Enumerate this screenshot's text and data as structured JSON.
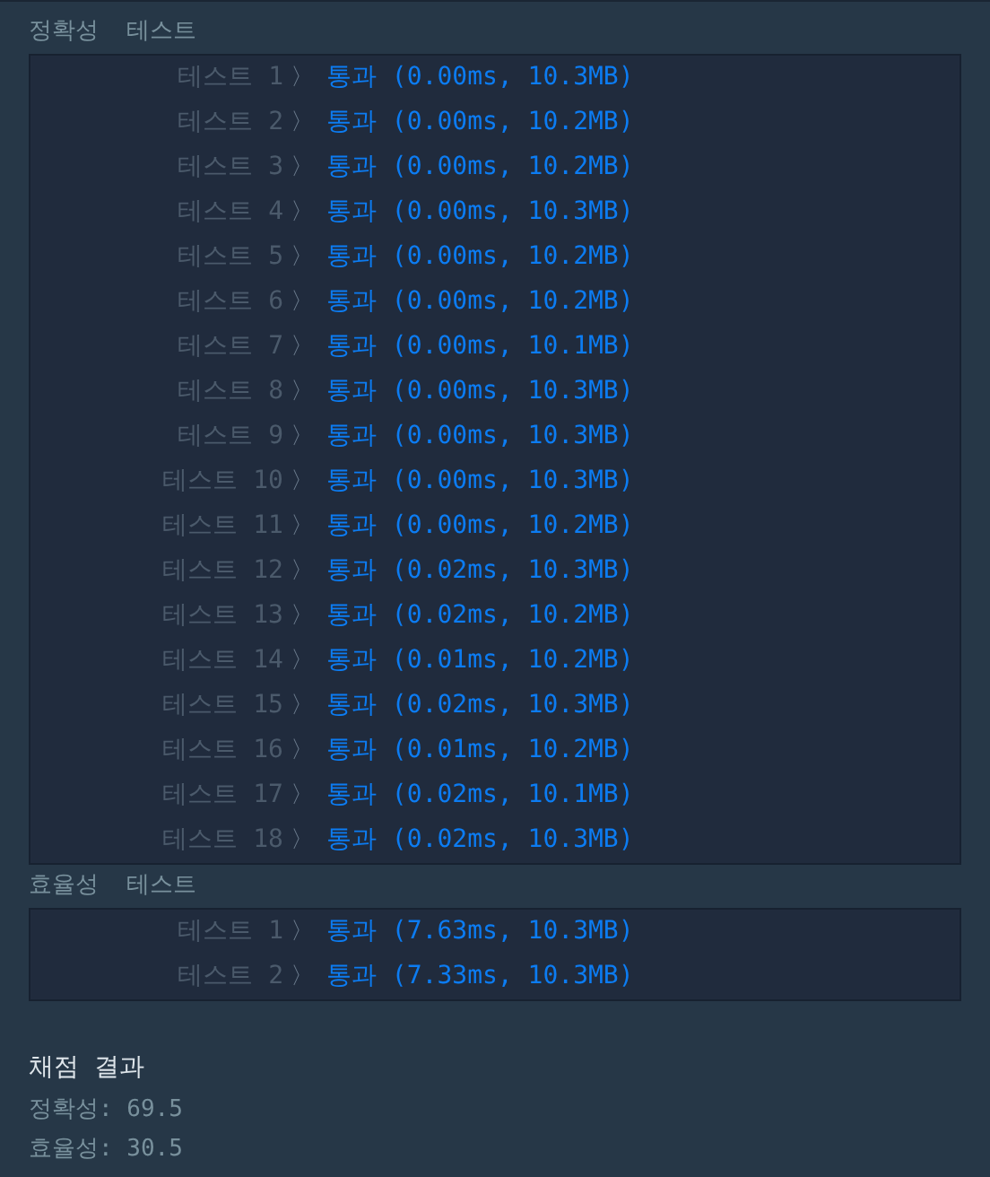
{
  "sections": [
    {
      "title": "정확성  테스트",
      "tests": [
        {
          "label": "테스트 1",
          "separator": "〉",
          "result": "통과 (0.00ms, 10.3MB)"
        },
        {
          "label": "테스트 2",
          "separator": "〉",
          "result": "통과 (0.00ms, 10.2MB)"
        },
        {
          "label": "테스트 3",
          "separator": "〉",
          "result": "통과 (0.00ms, 10.2MB)"
        },
        {
          "label": "테스트 4",
          "separator": "〉",
          "result": "통과 (0.00ms, 10.3MB)"
        },
        {
          "label": "테스트 5",
          "separator": "〉",
          "result": "통과 (0.00ms, 10.2MB)"
        },
        {
          "label": "테스트 6",
          "separator": "〉",
          "result": "통과 (0.00ms, 10.2MB)"
        },
        {
          "label": "테스트 7",
          "separator": "〉",
          "result": "통과 (0.00ms, 10.1MB)"
        },
        {
          "label": "테스트 8",
          "separator": "〉",
          "result": "통과 (0.00ms, 10.3MB)"
        },
        {
          "label": "테스트 9",
          "separator": "〉",
          "result": "통과 (0.00ms, 10.3MB)"
        },
        {
          "label": "테스트 10",
          "separator": "〉",
          "result": "통과 (0.00ms, 10.3MB)"
        },
        {
          "label": "테스트 11",
          "separator": "〉",
          "result": "통과 (0.00ms, 10.2MB)"
        },
        {
          "label": "테스트 12",
          "separator": "〉",
          "result": "통과 (0.02ms, 10.3MB)"
        },
        {
          "label": "테스트 13",
          "separator": "〉",
          "result": "통과 (0.02ms, 10.2MB)"
        },
        {
          "label": "테스트 14",
          "separator": "〉",
          "result": "통과 (0.01ms, 10.2MB)"
        },
        {
          "label": "테스트 15",
          "separator": "〉",
          "result": "통과 (0.02ms, 10.3MB)"
        },
        {
          "label": "테스트 16",
          "separator": "〉",
          "result": "통과 (0.01ms, 10.2MB)"
        },
        {
          "label": "테스트 17",
          "separator": "〉",
          "result": "통과 (0.02ms, 10.1MB)"
        },
        {
          "label": "테스트 18",
          "separator": "〉",
          "result": "통과 (0.02ms, 10.3MB)"
        }
      ]
    },
    {
      "title": "효율성  테스트",
      "tests": [
        {
          "label": "테스트 1",
          "separator": "〉",
          "result": "통과 (7.63ms, 10.3MB)"
        },
        {
          "label": "테스트 2",
          "separator": "〉",
          "result": "통과 (7.33ms, 10.3MB)"
        }
      ]
    }
  ],
  "summary": {
    "title": "채점 결과",
    "lines": [
      "정확성: 69.5",
      "효율성: 30.5"
    ]
  }
}
